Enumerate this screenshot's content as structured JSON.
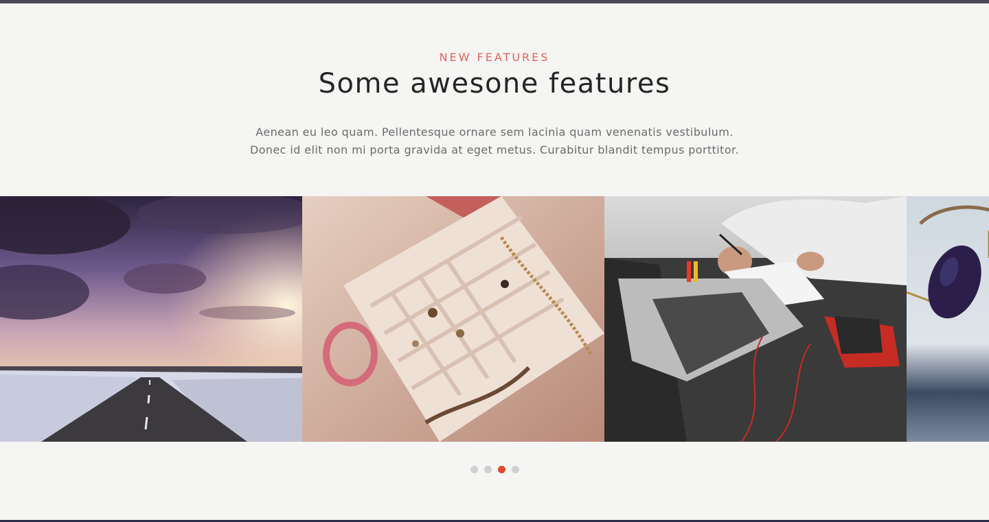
{
  "section": {
    "eyebrow": "NEW FEATURES",
    "title": "Some awesone features",
    "description_line_1": "Aenean eu leo quam. Pellentesque ornare sem lacinia quam venenatis vestibulum.",
    "description_line_2": "Donec id elit non mi porta gravida at eget metus. Curabitur blandit tempus porttitor."
  },
  "carousel": {
    "slides": [
      {
        "subject": "snowy country road at sunset"
      },
      {
        "subject": "jewelry box with necklaces and rings"
      },
      {
        "subject": "person writing beside laptop and phone"
      },
      {
        "subject": "sunglasses on table"
      }
    ],
    "dot_count": 4,
    "active_index": 2
  },
  "colors": {
    "accent": "#e8605a",
    "active_dot": "#e2492a",
    "inactive_dot": "#cfcfcf",
    "heading": "#252525",
    "body_text": "#6b6b6b",
    "background": "#f5f5f3"
  }
}
